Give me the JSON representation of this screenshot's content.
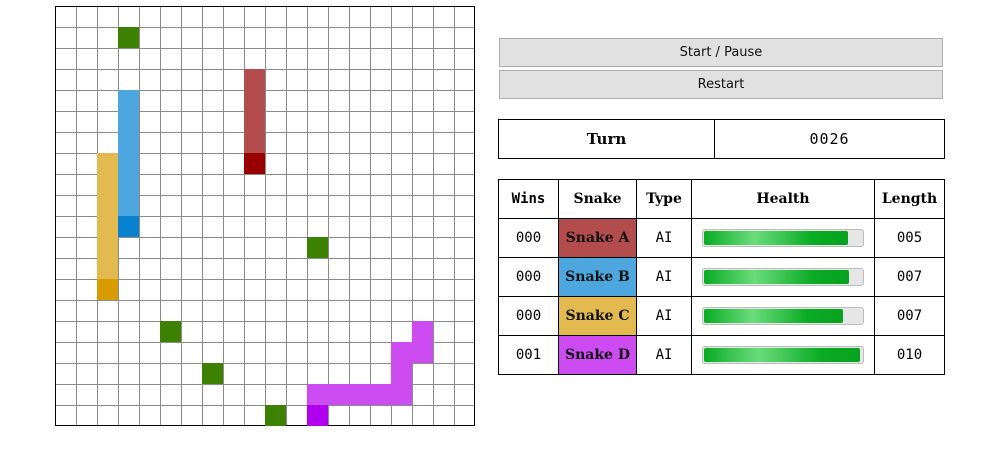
{
  "controls": {
    "start_label": "Start / Pause",
    "restart_label": "Restart"
  },
  "turn": {
    "label": "Turn",
    "value": "0026"
  },
  "board": {
    "cols": 20,
    "rows": 20,
    "grid_color": "#8c8c8c",
    "food_color": "#3c8200",
    "food": [
      [
        3,
        1
      ],
      [
        12,
        11
      ],
      [
        5,
        15
      ],
      [
        7,
        17
      ],
      [
        10,
        19
      ]
    ],
    "snakes": [
      {
        "color": "#b34d4d",
        "head_color": "#990000",
        "head": [
          9,
          7
        ],
        "body": [
          [
            9,
            3
          ],
          [
            9,
            4
          ],
          [
            9,
            5
          ],
          [
            9,
            6
          ]
        ]
      },
      {
        "color": "#4ea6de",
        "head_color": "#0a80d0",
        "head": [
          3,
          10
        ],
        "body": [
          [
            3,
            4
          ],
          [
            3,
            5
          ],
          [
            3,
            6
          ],
          [
            3,
            7
          ],
          [
            3,
            8
          ],
          [
            3,
            9
          ]
        ]
      },
      {
        "color": "#e2ba50",
        "head_color": "#d89b00",
        "head": [
          2,
          13
        ],
        "body": [
          [
            2,
            7
          ],
          [
            2,
            8
          ],
          [
            2,
            9
          ],
          [
            2,
            10
          ],
          [
            2,
            11
          ],
          [
            2,
            12
          ]
        ]
      },
      {
        "color": "#cc4cf2",
        "head_color": "#b000ee",
        "head": [
          12,
          19
        ],
        "body": [
          [
            17,
            15
          ],
          [
            17,
            16
          ],
          [
            16,
            16
          ],
          [
            16,
            17
          ],
          [
            16,
            18
          ],
          [
            15,
            18
          ],
          [
            14,
            18
          ],
          [
            13,
            18
          ],
          [
            12,
            18
          ]
        ]
      }
    ]
  },
  "stats": {
    "headers": {
      "wins": "Wins",
      "snake": "Snake",
      "type": "Type",
      "health": "Health",
      "length": "Length"
    },
    "rows": [
      {
        "wins": "000",
        "name": "Snake A",
        "color": "#b34d4d",
        "type": "AI",
        "health": 0.91,
        "length": "005"
      },
      {
        "wins": "000",
        "name": "Snake B",
        "color": "#4ea6de",
        "type": "AI",
        "health": 0.92,
        "length": "007"
      },
      {
        "wins": "000",
        "name": "Snake C",
        "color": "#e2ba50",
        "type": "AI",
        "health": 0.88,
        "length": "007"
      },
      {
        "wins": "001",
        "name": "Snake D",
        "color": "#cc4cf2",
        "type": "AI",
        "health": 0.99,
        "length": "010"
      }
    ]
  }
}
